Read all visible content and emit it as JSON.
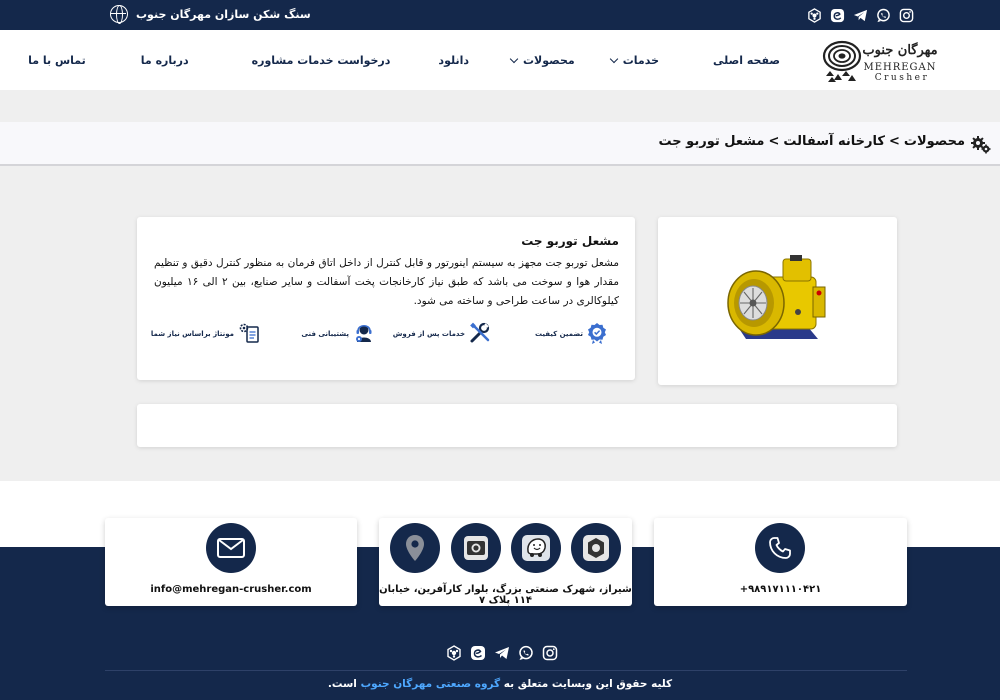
{
  "topbar": {
    "brand_text": "سنگ شکن سازان مهرگان جنوب",
    "social_icons": [
      "instagram-icon",
      "whatsapp-icon",
      "telegram-icon",
      "eitaa-icon",
      "bale-icon"
    ]
  },
  "logo": {
    "line1": "مهرگان جنوب",
    "line2": "MEHREGAN",
    "line3": "Crusher"
  },
  "nav": {
    "home": "صفحه اصلی",
    "services": "خدمات",
    "products": "محصولات",
    "download": "دانلود",
    "consult": "درخواست خدمات مشاوره",
    "about": "درباره ما",
    "contact": "تماس با ما"
  },
  "breadcrumb": {
    "items": [
      "محصولات",
      "کارخانه آسفالت",
      "مشعل توربو جت"
    ],
    "separator": ">"
  },
  "product": {
    "title": "مشعل توربو جت",
    "description": "مشعل توربو جت مجهز به سیستم اینورتور و قابل کنترل از داخل اتاق فرمان به منظور کنترل دقیق و تنظیم مقدار هوا و سوخت می باشد که طبق نیاز کارخانجات پخت آسفالت و سایر صنایع، بین ۲ الی ۱۶ میلیون کیلوکالری در ساعت طراحی و ساخته می شود.",
    "features": {
      "quality": "تضمین کیفیت",
      "after_sales": "خدمات پس از فروش",
      "support": "پشتیبانی فنی",
      "assembly": "مونتاژ براساس نیاز شما"
    }
  },
  "footer": {
    "phone": "۰۲۱-۹۱۱۱۰۴۲۱",
    "phone_display": "+۹۸۹۱۷۱۱۱۰۴۲۱",
    "address": "شیراز، شهرک صنعتی بزرگ، بلوار کارآفرین، خیابان ۱۱۴ پلاک ۷",
    "email": "info@mehregan-crusher.com",
    "copyright_before": "کلیه حقوق این وبسایت متعلق به ",
    "copyright_link": "گروه صنعتی مهرگان جنوب",
    "copyright_after": " است."
  },
  "colors": {
    "navy": "#14284b",
    "link_blue": "#4ea8ff",
    "bg_grey": "#efefef"
  }
}
